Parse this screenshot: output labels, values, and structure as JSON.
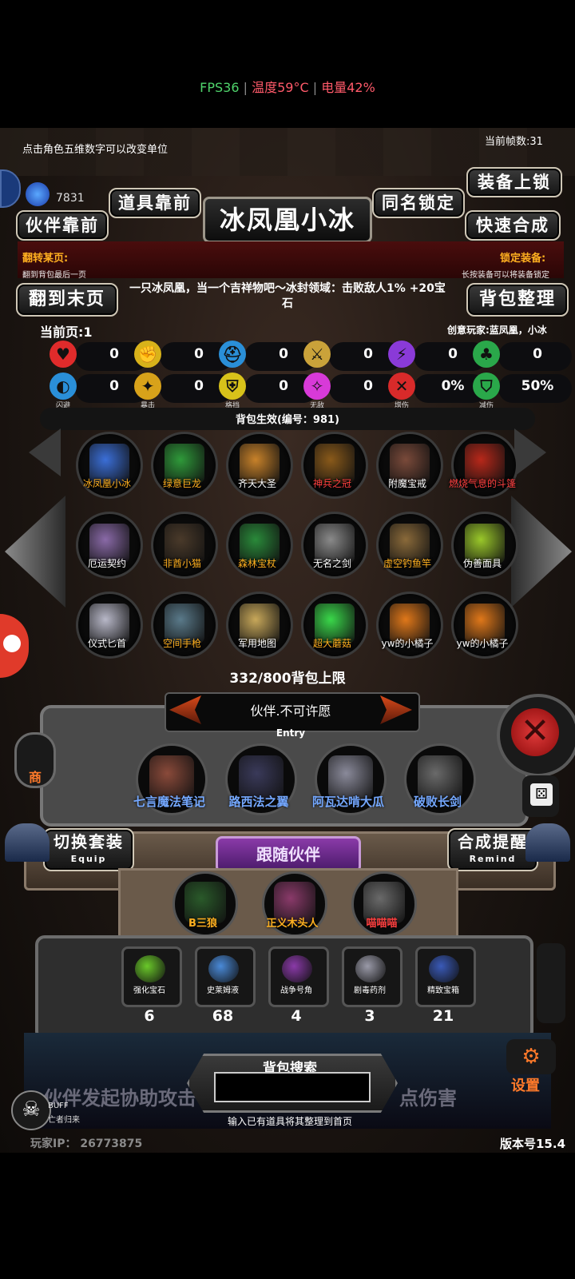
{
  "status": {
    "fps": "FPS36",
    "temp": "温度59°C",
    "battery": "电量42%",
    "sep": "|"
  },
  "hint_top": "点击角色五维数字可以改变单位",
  "frame_count": "当前帧数:31",
  "gem_count": "7831",
  "buttons": {
    "equip_lock": "装备上锁",
    "item_front": "道具靠前",
    "same_name_lock": "同名锁定",
    "partner_front": "伙伴靠前",
    "quick_compose": "快速合成",
    "go_last_page": "翻到末页",
    "sort_bag": "背包整理"
  },
  "title": "冰凤凰小冰",
  "flip_page": {
    "label": "翻转某页:",
    "desc": "翻到背包最后一页"
  },
  "lock_equip": {
    "label": "锁定装备:",
    "desc": "长按装备可以将装备锁定"
  },
  "description": "一只冰凤凰，当一个吉祥物吧～冰封领域：击败敌人1% +20宝石",
  "current_page": "当前页:1",
  "creator": "创意玩家:蓝凤凰，小冰",
  "stats_row1": [
    {
      "icon": "heart-icon",
      "value": "0",
      "color": "#e02b2b",
      "glyph": "♥"
    },
    {
      "icon": "strength-icon",
      "value": "0",
      "color": "#d8b21a",
      "glyph": "✊"
    },
    {
      "icon": "helmet-icon",
      "value": "0",
      "color": "#2a8fd8",
      "glyph": "⛑"
    },
    {
      "icon": "sword-icon",
      "value": "0",
      "color": "#caa23a",
      "glyph": "⚔"
    },
    {
      "icon": "lightning-icon",
      "value": "0",
      "color": "#8a3ad8",
      "glyph": "⚡"
    },
    {
      "icon": "clover-icon",
      "value": "0",
      "color": "#2aa84a",
      "glyph": "♣"
    }
  ],
  "stats_row2": [
    {
      "icon": "dodge-icon",
      "value": "0",
      "label": "闪避",
      "color": "#2a8fd8",
      "glyph": "◐"
    },
    {
      "icon": "crit-icon",
      "value": "0",
      "label": "暴击",
      "color": "#d8a21a",
      "glyph": "✦"
    },
    {
      "icon": "block-icon",
      "value": "0",
      "label": "格挡",
      "color": "#d8c21a",
      "glyph": "⛨"
    },
    {
      "icon": "invincible-icon",
      "value": "0",
      "label": "无敌",
      "color": "#d83ad8",
      "glyph": "✧"
    },
    {
      "icon": "damage-up-icon",
      "value": "0%",
      "label": "增伤",
      "color": "#d82a2a",
      "glyph": "✕"
    },
    {
      "icon": "damage-reduce-icon",
      "value": "50%",
      "label": "减伤",
      "color": "#2aa84a",
      "glyph": "⛉"
    }
  ],
  "bag_effect": "背包生效(编号：981)",
  "items": [
    {
      "name": "冰凤凰小冰",
      "color": "#ffb020",
      "pic": "#3b6fd8"
    },
    {
      "name": "绿意巨龙",
      "color": "#ffb020",
      "pic": "#2f9a3a"
    },
    {
      "name": "齐天大圣",
      "color": "#ffffff",
      "pic": "#c8822a"
    },
    {
      "name": "神兵之冠",
      "color": "#ff4040",
      "pic": "#8a5a1a"
    },
    {
      "name": "附魔宝戒",
      "color": "#ffffff",
      "pic": "#7a4a3a"
    },
    {
      "name": "燃烧气息的斗篷",
      "color": "#ff4040",
      "pic": "#b8281a"
    },
    {
      "name": "厄运契约",
      "color": "#ffffff",
      "pic": "#8a6aa8"
    },
    {
      "name": "非酋小猫",
      "color": "#ffb020",
      "pic": "#4a3a2a"
    },
    {
      "name": "森林宝杖",
      "color": "#ffb020",
      "pic": "#2a8a3a"
    },
    {
      "name": "无名之剑",
      "color": "#ffffff",
      "pic": "#8a8a8a"
    },
    {
      "name": "虚空钓鱼竿",
      "color": "#ffb020",
      "pic": "#8a6a3a"
    },
    {
      "name": "伪善面具",
      "color": "#ffffff",
      "pic": "#9ac82a"
    },
    {
      "name": "仪式匕首",
      "color": "#ffffff",
      "pic": "#b8b8c8"
    },
    {
      "name": "空间手枪",
      "color": "#ffb020",
      "pic": "#5a7a8a"
    },
    {
      "name": "军用地图",
      "color": "#ffffff",
      "pic": "#c8a85a"
    },
    {
      "name": "超大蘑菇",
      "color": "#ffb020",
      "pic": "#3ad84a"
    },
    {
      "name": "yw的小橘子",
      "color": "#ffffff",
      "pic": "#e0781a"
    },
    {
      "name": "yw的小橘子",
      "color": "#ffffff",
      "pic": "#e0781a"
    }
  ],
  "bag_limit": "332/800背包上限",
  "entry": {
    "title": "伙伴.不可许愿",
    "sub": "Entry"
  },
  "companion_items": [
    {
      "name": "七言魔法笔记",
      "pic": "#8a4a3a"
    },
    {
      "name": "路西法之翼",
      "pic": "#3a3a5a"
    },
    {
      "name": "阿瓦达啃大瓜",
      "pic": "#8a8a9a"
    },
    {
      "name": "破败长剑",
      "pic": "#6a6a6a"
    }
  ],
  "switch_set": {
    "label": "切换套装",
    "sub": "Equip"
  },
  "compose_remind": {
    "label": "合成提醒",
    "sub": "Remind"
  },
  "follow_partner": "跟随伙伴",
  "partners": [
    {
      "name": "B三狼",
      "color": "#ffb020",
      "pic": "#2a5a2a"
    },
    {
      "name": "正义木头人",
      "color": "#ffb020",
      "pic": "#8a3a6a"
    },
    {
      "name": "喵喵喵",
      "color": "#ff4040",
      "pic": "#6a6a6a"
    }
  ],
  "resources": [
    {
      "name": "强化宝石",
      "count": "6",
      "pic": "#6ac82a"
    },
    {
      "name": "史莱姆液",
      "count": "68",
      "pic": "#4a8ad8"
    },
    {
      "name": "战争号角",
      "count": "4",
      "pic": "#8a3aa8"
    },
    {
      "name": "剧毒药剂",
      "count": "3",
      "pic": "#9a9aa8"
    },
    {
      "name": "精致宝箱",
      "count": "21",
      "pic": "#3a5ab8"
    }
  ],
  "bag_search": {
    "label": "背包搜索",
    "hint": "输入已有道具将其整理到首页",
    "value": ""
  },
  "bg_text_left": "伙伴发起协助攻击",
  "bg_text_right": "点伤害",
  "settings": "设置",
  "shop": "商",
  "buff": {
    "label": "BUFF",
    "sub": "亡者归来"
  },
  "player_ip": "玩家IP：  26773875",
  "version": "版本号15.4"
}
